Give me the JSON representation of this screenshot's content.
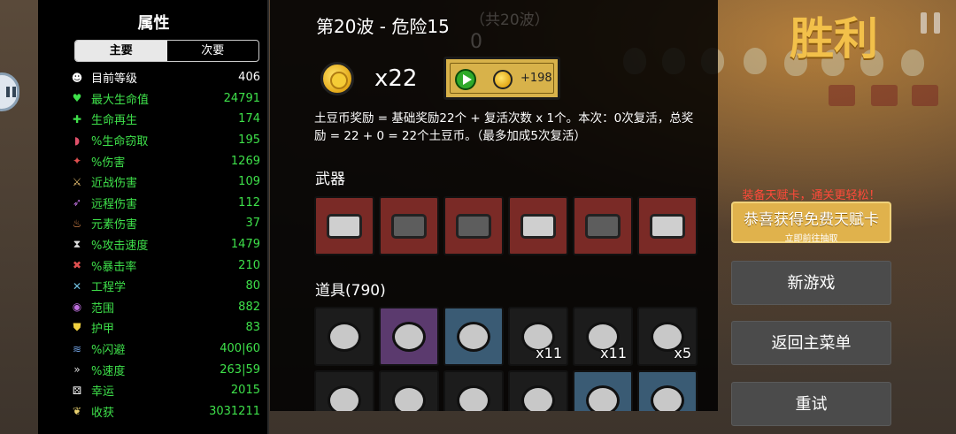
{
  "stats_panel": {
    "title": "属性",
    "tabs": [
      {
        "label": "主要",
        "active": true
      },
      {
        "label": "次要",
        "active": false
      }
    ],
    "rows": [
      {
        "icon": "level-icon",
        "label": "目前等级",
        "value": "406",
        "color": "white"
      },
      {
        "icon": "heart-icon",
        "label": "最大生命值",
        "value": "24791",
        "color": "green"
      },
      {
        "icon": "regen-icon",
        "label": "生命再生",
        "value": "174",
        "color": "green"
      },
      {
        "icon": "lifesteal-icon",
        "label": "%生命窃取",
        "value": "195",
        "color": "green"
      },
      {
        "icon": "damage-icon",
        "label": "%伤害",
        "value": "1269",
        "color": "green"
      },
      {
        "icon": "melee-icon",
        "label": "近战伤害",
        "value": "109",
        "color": "green"
      },
      {
        "icon": "ranged-icon",
        "label": "远程伤害",
        "value": "112",
        "color": "green"
      },
      {
        "icon": "elemental-icon",
        "label": "元素伤害",
        "value": "37",
        "color": "green"
      },
      {
        "icon": "attack-speed-icon",
        "label": "%攻击速度",
        "value": "1479",
        "color": "green"
      },
      {
        "icon": "crit-icon",
        "label": "%暴击率",
        "value": "210",
        "color": "green"
      },
      {
        "icon": "engineering-icon",
        "label": "工程学",
        "value": "80",
        "color": "green"
      },
      {
        "icon": "range-icon",
        "label": "范围",
        "value": "882",
        "color": "green"
      },
      {
        "icon": "armor-icon",
        "label": "护甲",
        "value": "83",
        "color": "green"
      },
      {
        "icon": "dodge-icon",
        "label": "%闪避",
        "value": "400|60",
        "color": "green"
      },
      {
        "icon": "speed-icon",
        "label": "%速度",
        "value": "263|59",
        "color": "green"
      },
      {
        "icon": "luck-icon",
        "label": "幸运",
        "value": "2015",
        "color": "green"
      },
      {
        "icon": "harvest-icon",
        "label": "收获",
        "value": "3031211",
        "color": "green"
      }
    ]
  },
  "main_panel": {
    "wave_title": "第20波 - 危险15",
    "bg_text_wave": "（共20波）",
    "bg_text_count": "0",
    "coin_count": "x22",
    "revive_button_amount": "+198",
    "reward_text": "土豆币奖励 = 基础奖励22个 + 复活次数 x 1个。本次：0次复活，总奖励 = 22 + 0 = 22个土豆币。（最多加成5次复活）",
    "weapons_label": "武器",
    "weapons": [
      {
        "icon": "gun-icon"
      },
      {
        "icon": "minigun-icon"
      },
      {
        "icon": "minigun-icon"
      },
      {
        "icon": "gun-icon"
      },
      {
        "icon": "minigun-icon"
      },
      {
        "icon": "pistol-icon"
      }
    ],
    "items_label": "道具(790)",
    "items_row1": [
      {
        "icon": "crown-icon",
        "qty": "",
        "bg": "dark"
      },
      {
        "icon": "shield-disc-icon",
        "qty": "",
        "bg": "purple"
      },
      {
        "icon": "clown-icon",
        "qty": "",
        "bg": "blue"
      },
      {
        "icon": "butterfly-icon",
        "qty": "x11",
        "bg": "dark"
      },
      {
        "icon": "barbed-wire-icon",
        "qty": "x11",
        "bg": "dark"
      },
      {
        "icon": "banknote-icon",
        "qty": "x5",
        "bg": "dark"
      }
    ],
    "items_row2": [
      {
        "icon": "shirt-icon",
        "bg": "dark"
      },
      {
        "icon": "bag-icon",
        "bg": "dark"
      },
      {
        "icon": "broccoli-icon",
        "bg": "dark"
      },
      {
        "icon": "glasses-icon",
        "bg": "dark"
      },
      {
        "icon": "potion-icon",
        "bg": "blue"
      },
      {
        "icon": "robot-icon",
        "bg": "blue"
      }
    ]
  },
  "right_panel": {
    "victory": "胜利",
    "promo_top": "装备天赋卡，通关更轻松！",
    "promo_main": "恭喜获得免费天赋卡",
    "promo_sub": "立即前往抽取",
    "new_game": "新游戏",
    "main_menu": "返回主菜单",
    "retry": "重试"
  },
  "colors": {
    "accent_gold": "#f2c04a",
    "stat_green": "#3ee04a",
    "weapon_slot": "#7a2a26"
  }
}
